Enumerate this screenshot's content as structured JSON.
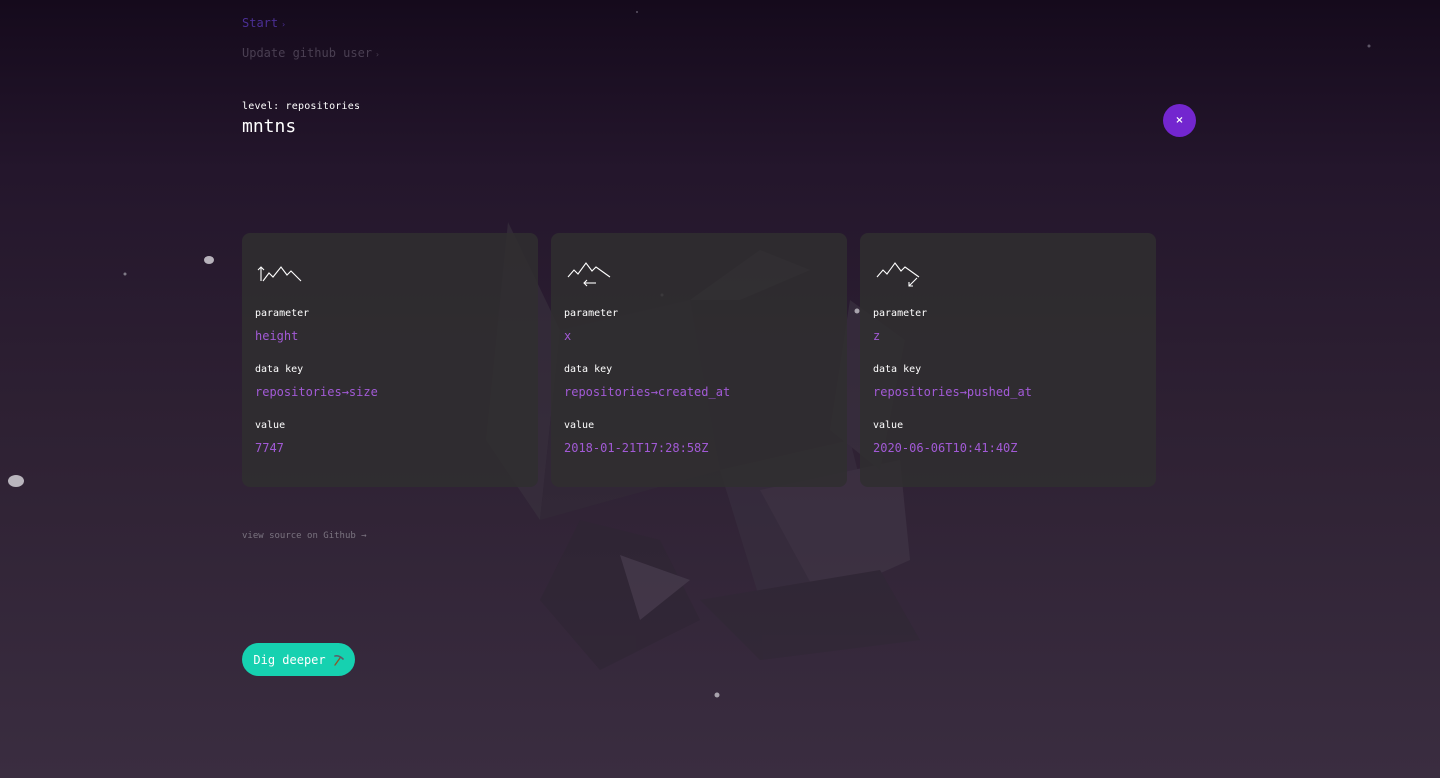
{
  "breadcrumb": {
    "items": [
      {
        "label": "Start",
        "arrow": "›"
      },
      {
        "label": "Update github user",
        "arrow": "›"
      }
    ]
  },
  "header": {
    "level_label": "level: repositories",
    "title": "mntns",
    "close_label": "×"
  },
  "cards": [
    {
      "icon": "mountain-height-icon",
      "param_label": "parameter",
      "param_value": "height",
      "key_label": "data key",
      "key_value": "repositories→size",
      "value_label": "value",
      "value_value": "7747"
    },
    {
      "icon": "mountain-x-axis-icon",
      "param_label": "parameter",
      "param_value": "x",
      "key_label": "data key",
      "key_value": "repositories→created_at",
      "value_label": "value",
      "value_value": "2018-01-21T17:28:58Z"
    },
    {
      "icon": "mountain-z-axis-icon",
      "param_label": "parameter",
      "param_value": "z",
      "key_label": "data key",
      "key_value": "repositories→pushed_at",
      "value_label": "value",
      "value_value": "2020-06-06T10:41:40Z"
    }
  ],
  "footer": {
    "source_link": "view source on Github →",
    "dig_button": "Dig deeper"
  },
  "colors": {
    "accent_purple": "#7326cf",
    "value_purple": "#a25ad6",
    "teal": "#16d1b0"
  }
}
